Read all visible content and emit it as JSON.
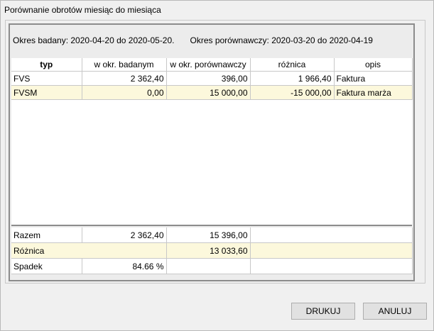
{
  "window": {
    "title": "Porównanie obrotów miesiąc do miesiąca"
  },
  "periods": {
    "examined": "Okres badany: 2020-04-20 do 2020-05-20.",
    "comparative": "Okres porównawczy: 2020-03-20 do 2020-04-19"
  },
  "table": {
    "columns": [
      "typ",
      "w okr. badanym",
      "w okr. porównawczy",
      "różnica",
      "opis"
    ],
    "rows": [
      {
        "typ": "FVS",
        "badany": "2 362,40",
        "porownawczy": "396,00",
        "roznica": "1 966,40",
        "opis": "Faktura"
      },
      {
        "typ": "FVSM",
        "badany": "0,00",
        "porownawczy": "15 000,00",
        "roznica": "-15 000,00",
        "opis": "Faktura marża"
      }
    ]
  },
  "summary": {
    "razem_label": "Razem",
    "razem_badany": "2 362,40",
    "razem_porownawczy": "15 396,00",
    "roznica_label": "Różnica",
    "roznica_value": "13 033,60",
    "spadek_label": "Spadek",
    "spadek_value": "84.66 %"
  },
  "buttons": {
    "print": "DRUKUJ",
    "cancel": "ANULUJ"
  }
}
